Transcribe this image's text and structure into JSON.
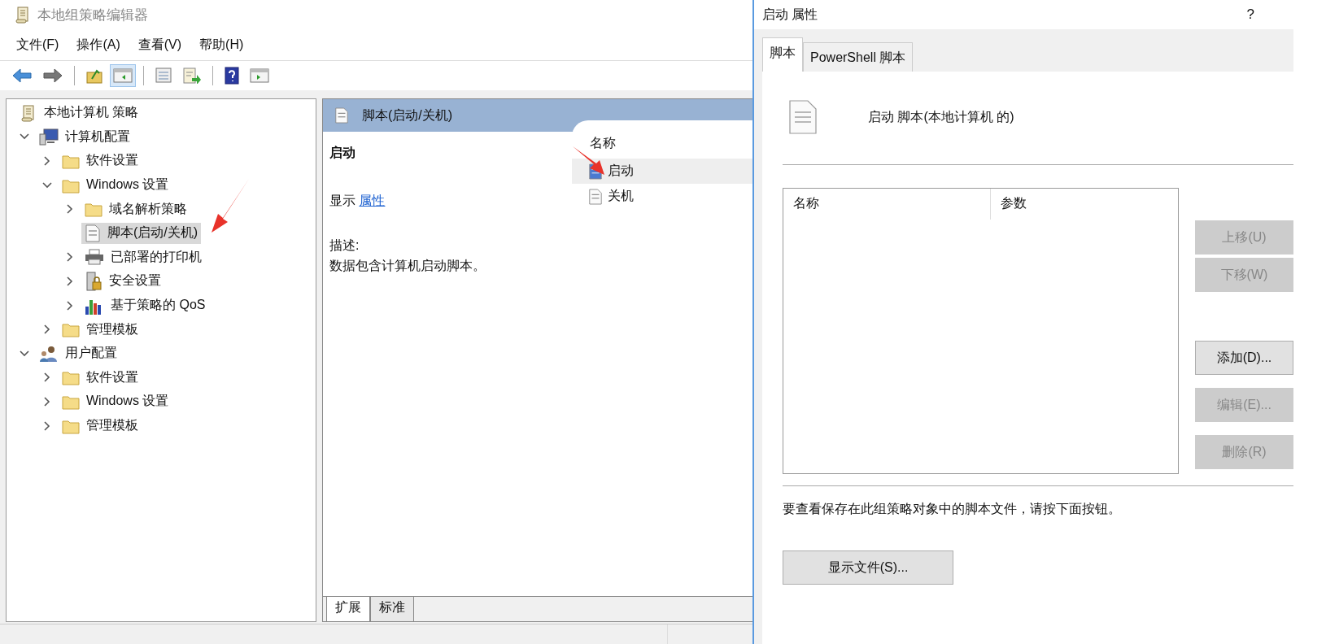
{
  "main_window": {
    "title": "本地组策略编辑器",
    "menu": [
      "文件(F)",
      "操作(A)",
      "查看(V)",
      "帮助(H)"
    ],
    "toolbar": [
      {
        "kind": "back",
        "pressed": false
      },
      {
        "kind": "forward",
        "pressed": false
      },
      {
        "kind": "separator"
      },
      {
        "kind": "up",
        "pressed": false
      },
      {
        "kind": "tree",
        "pressed": true
      },
      {
        "kind": "separator"
      },
      {
        "kind": "properties",
        "pressed": false
      },
      {
        "kind": "export",
        "pressed": false
      },
      {
        "kind": "separator"
      },
      {
        "kind": "help",
        "pressed": false
      },
      {
        "kind": "pane",
        "pressed": false
      }
    ],
    "tree": [
      {
        "label": "本地计算机 策略",
        "kind": "policy",
        "selected": false,
        "children": [
          {
            "label": "计算机配置",
            "kind": "computer",
            "expanded": true,
            "selected": false,
            "children": [
              {
                "label": "软件设置",
                "kind": "folder",
                "expanded": false,
                "selected": false
              },
              {
                "label": "Windows 设置",
                "kind": "folder",
                "expanded": true,
                "selected": false,
                "children": [
                  {
                    "label": "域名解析策略",
                    "kind": "folder",
                    "expanded": false,
                    "selected": false
                  },
                  {
                    "label": "脚本(启动/关机)",
                    "kind": "script",
                    "selected": true
                  },
                  {
                    "label": "已部署的打印机",
                    "kind": "printer",
                    "expanded": false,
                    "selected": false
                  },
                  {
                    "label": "安全设置",
                    "kind": "security",
                    "expanded": false,
                    "selected": false
                  },
                  {
                    "label": "基于策略的 QoS",
                    "kind": "qos",
                    "expanded": false,
                    "selected": false
                  }
                ]
              },
              {
                "label": "管理模板",
                "kind": "folder",
                "expanded": false,
                "selected": false
              }
            ]
          },
          {
            "label": "用户配置",
            "kind": "user",
            "expanded": true,
            "selected": false,
            "children": [
              {
                "label": "软件设置",
                "kind": "folder",
                "expanded": false,
                "selected": false
              },
              {
                "label": "Windows 设置",
                "kind": "folder",
                "expanded": false,
                "selected": false
              },
              {
                "label": "管理模板",
                "kind": "folder",
                "expanded": false,
                "selected": false
              }
            ]
          }
        ]
      }
    ],
    "details": {
      "header": "脚本(启动/关机)",
      "item_title": "启动",
      "show_label": "显示",
      "properties_link": "属性",
      "description_label": "描述:",
      "description": "数据包含计算机启动脚本。",
      "list_column": "名称",
      "list_items": [
        {
          "label": "启动",
          "selected": true
        },
        {
          "label": "关机",
          "selected": false
        }
      ],
      "bottom_tabs": [
        {
          "label": "扩展",
          "selected": true
        },
        {
          "label": "标准",
          "selected": false
        }
      ]
    }
  },
  "dialog": {
    "title": "启动 属性",
    "help": "?",
    "tabs": [
      {
        "label": "脚本",
        "selected": true
      },
      {
        "label": "PowerShell 脚本",
        "selected": false
      }
    ],
    "heading": "启动 脚本(本地计算机 的)",
    "table": {
      "columns": [
        "名称",
        "参数"
      ]
    },
    "buttons": [
      {
        "label": "上移(U)",
        "disabled": true
      },
      {
        "label": "下移(W)",
        "disabled": true
      },
      {
        "label": "添加(D)...",
        "disabled": false
      },
      {
        "label": "编辑(E)...",
        "disabled": true
      },
      {
        "label": "删除(R)",
        "disabled": true
      }
    ],
    "note": "要查看保存在此组策略对象中的脚本文件，请按下面按钮。",
    "show_files_button": "显示文件(S)..."
  }
}
